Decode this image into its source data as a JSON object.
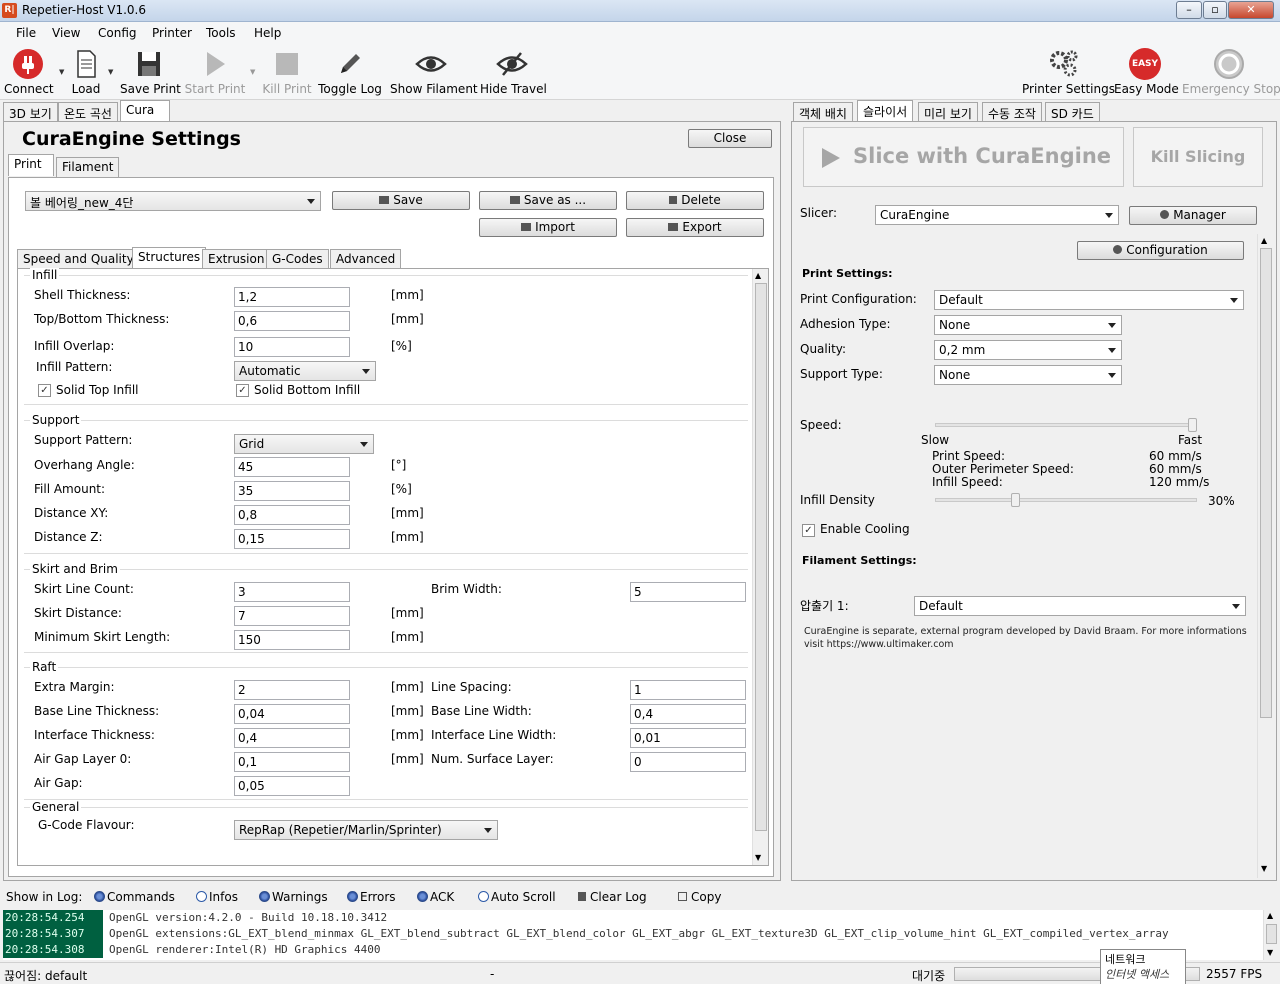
{
  "window": {
    "title": "Repetier-Host V1.0.6",
    "icon_text": "R|"
  },
  "menu": [
    "File",
    "View",
    "Config",
    "Printer",
    "Tools",
    "Help"
  ],
  "toolbar": {
    "connect": "Connect",
    "load": "Load",
    "save_print": "Save Print",
    "start_print": "Start Print",
    "kill_print": "Kill Print",
    "toggle_log": "Toggle Log",
    "show_filament": "Show Filament",
    "hide_travel": "Hide Travel",
    "printer_settings": "Printer Settings",
    "easy_mode": "Easy Mode",
    "easy_badge": "EASY",
    "emergency_stop": "Emergency Stop"
  },
  "left_tabs": [
    "3D 보기",
    "온도 곡선",
    "Cura"
  ],
  "cura": {
    "title": "CuraEngine Settings",
    "close": "Close",
    "subtabs": [
      "Print",
      "Filament"
    ],
    "profile": "볼 베어링_new_4단",
    "save": "Save",
    "save_as": "Save as ...",
    "delete": "Delete",
    "import": "Import",
    "export": "Export",
    "section_tabs": [
      "Speed and Quality",
      "Structures",
      "Extrusion",
      "G-Codes",
      "Advanced"
    ],
    "infill": {
      "title": "Infill",
      "shell_label": "Shell Thickness:",
      "shell_value": "1,2",
      "shell_unit": "[mm]",
      "topbottom_label": "Top/Bottom Thickness:",
      "topbottom_value": "0,6",
      "topbottom_unit": "[mm]",
      "overlap_label": "Infill Overlap:",
      "overlap_value": "10",
      "overlap_unit": "[%]",
      "pattern_label": "Infill Pattern:",
      "pattern_value": "Automatic",
      "solid_top": "Solid Top Infill",
      "solid_bottom": "Solid Bottom Infill"
    },
    "support": {
      "title": "Support",
      "pattern_label": "Support Pattern:",
      "pattern_value": "Grid",
      "overhang_label": "Overhang Angle:",
      "overhang_value": "45",
      "overhang_unit": "[°]",
      "fill_label": "Fill Amount:",
      "fill_value": "35",
      "fill_unit": "[%]",
      "xy_label": "Distance XY:",
      "xy_value": "0,8",
      "xy_unit": "[mm]",
      "z_label": "Distance Z:",
      "z_value": "0,15",
      "z_unit": "[mm]"
    },
    "skirt": {
      "title": "Skirt and Brim",
      "count_label": "Skirt Line Count:",
      "count_value": "3",
      "brim_label": "Brim Width:",
      "brim_value": "5",
      "distance_label": "Skirt Distance:",
      "distance_value": "7",
      "distance_unit": "[mm]",
      "min_label": "Minimum Skirt Length:",
      "min_value": "150",
      "min_unit": "[mm]"
    },
    "raft": {
      "title": "Raft",
      "extra_label": "Extra Margin:",
      "extra_value": "2",
      "extra_unit": "[mm]",
      "spacing_label": "Line Spacing:",
      "spacing_value": "1",
      "base_thick_label": "Base Line Thickness:",
      "base_thick_value": "0,04",
      "base_thick_unit": "[mm]",
      "base_width_label": "Base Line Width:",
      "base_width_value": "0,4",
      "iface_thick_label": "Interface Thickness:",
      "iface_thick_value": "0,4",
      "iface_thick_unit": "[mm]",
      "iface_width_label": "Interface Line Width:",
      "iface_width_value": "0,01",
      "airgap0_label": "Air Gap Layer 0:",
      "airgap0_value": "0,1",
      "airgap0_unit": "[mm]",
      "surface_label": "Num. Surface Layer:",
      "surface_value": "0",
      "airgap_label": "Air Gap:",
      "airgap_value": "0,05"
    },
    "general": {
      "title": "General",
      "flavour_label": "G-Code Flavour:",
      "flavour_value": "RepRap (Repetier/Marlin/Sprinter)"
    }
  },
  "right_tabs": [
    "객체 배치",
    "슬라이서",
    "미리 보기",
    "수동 조작",
    "SD 카드"
  ],
  "slicer": {
    "slice_btn": "Slice with CuraEngine",
    "kill_btn": "Kill Slicing",
    "slicer_label": "Slicer:",
    "slicer_value": "CuraEngine",
    "manager": "Manager",
    "configuration": "Configuration",
    "print_settings": "Print Settings:",
    "print_config_label": "Print Configuration:",
    "print_config_value": "Default",
    "adhesion_label": "Adhesion Type:",
    "adhesion_value": "None",
    "quality_label": "Quality:",
    "quality_value": "0,2 mm",
    "support_label": "Support Type:",
    "support_value": "None",
    "speed_label": "Speed:",
    "speed_level": 1.0,
    "slow": "Slow",
    "fast": "Fast",
    "print_speed_label": "Print Speed:",
    "print_speed_value": "60 mm/s",
    "outer_speed_label": "Outer Perimeter Speed:",
    "outer_speed_value": "60 mm/s",
    "infill_speed_label": "Infill Speed:",
    "infill_speed_value": "120 mm/s",
    "density_label": "Infill Density",
    "density_value": "30%",
    "density_level": 0.3,
    "cooling": "Enable Cooling",
    "filament_settings": "Filament Settings:",
    "extruder_label": "압출기 1:",
    "extruder_value": "Default",
    "note": "CuraEngine is separate, external program developed by David Braam. For more informations visit https://www.ultimaker.com"
  },
  "log": {
    "show_label": "Show in Log:",
    "filters": [
      "Commands",
      "Infos",
      "Warnings",
      "Errors",
      "ACK",
      "Auto Scroll"
    ],
    "clear": "Clear Log",
    "copy": "Copy",
    "rows": [
      {
        "time": "20:28:54.254",
        "msg": "OpenGL version:4.2.0 - Build 10.18.10.3412"
      },
      {
        "time": "20:28:54.307",
        "msg": "OpenGL extensions:GL_EXT_blend_minmax GL_EXT_blend_subtract GL_EXT_blend_color GL_EXT_abgr GL_EXT_texture3D GL_EXT_clip_volume_hint GL_EXT_compiled_vertex_array"
      },
      {
        "time": "20:28:54.308",
        "msg": "OpenGL renderer:Intel(R) HD Graphics 4400"
      }
    ]
  },
  "status": {
    "left": "끊어짐: default",
    "middle": "-",
    "waiting": "대기중",
    "fps": "2557 FPS",
    "tooltip_line1": "네트워크",
    "tooltip_line2": "인터넷 액세스"
  },
  "colors": {
    "accent_red": "#d62a2a",
    "log_time_bg": "#006040"
  }
}
